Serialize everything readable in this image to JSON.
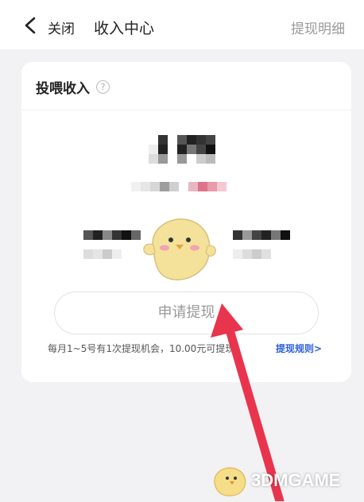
{
  "topbar": {
    "back_icon": "chevron-left-icon",
    "close_label": "关闭",
    "title": "收入中心",
    "detail_link": "提现明细"
  },
  "card": {
    "title": "投喂收入",
    "help_icon": "question-circle-icon",
    "help_glyph": "?",
    "withdraw_button": "申请提现",
    "rule_text": "每月1~5号有1次提现机会，10.00元可提现，",
    "rule_link": "提现规则>"
  },
  "watermark": {
    "text": "3DMGAME"
  },
  "colors": {
    "page_bg": "#f2f2f4",
    "link_blue": "#2f62d9",
    "arrow_red": "#e8354d",
    "mascot_yellow": "#f4e19a"
  }
}
